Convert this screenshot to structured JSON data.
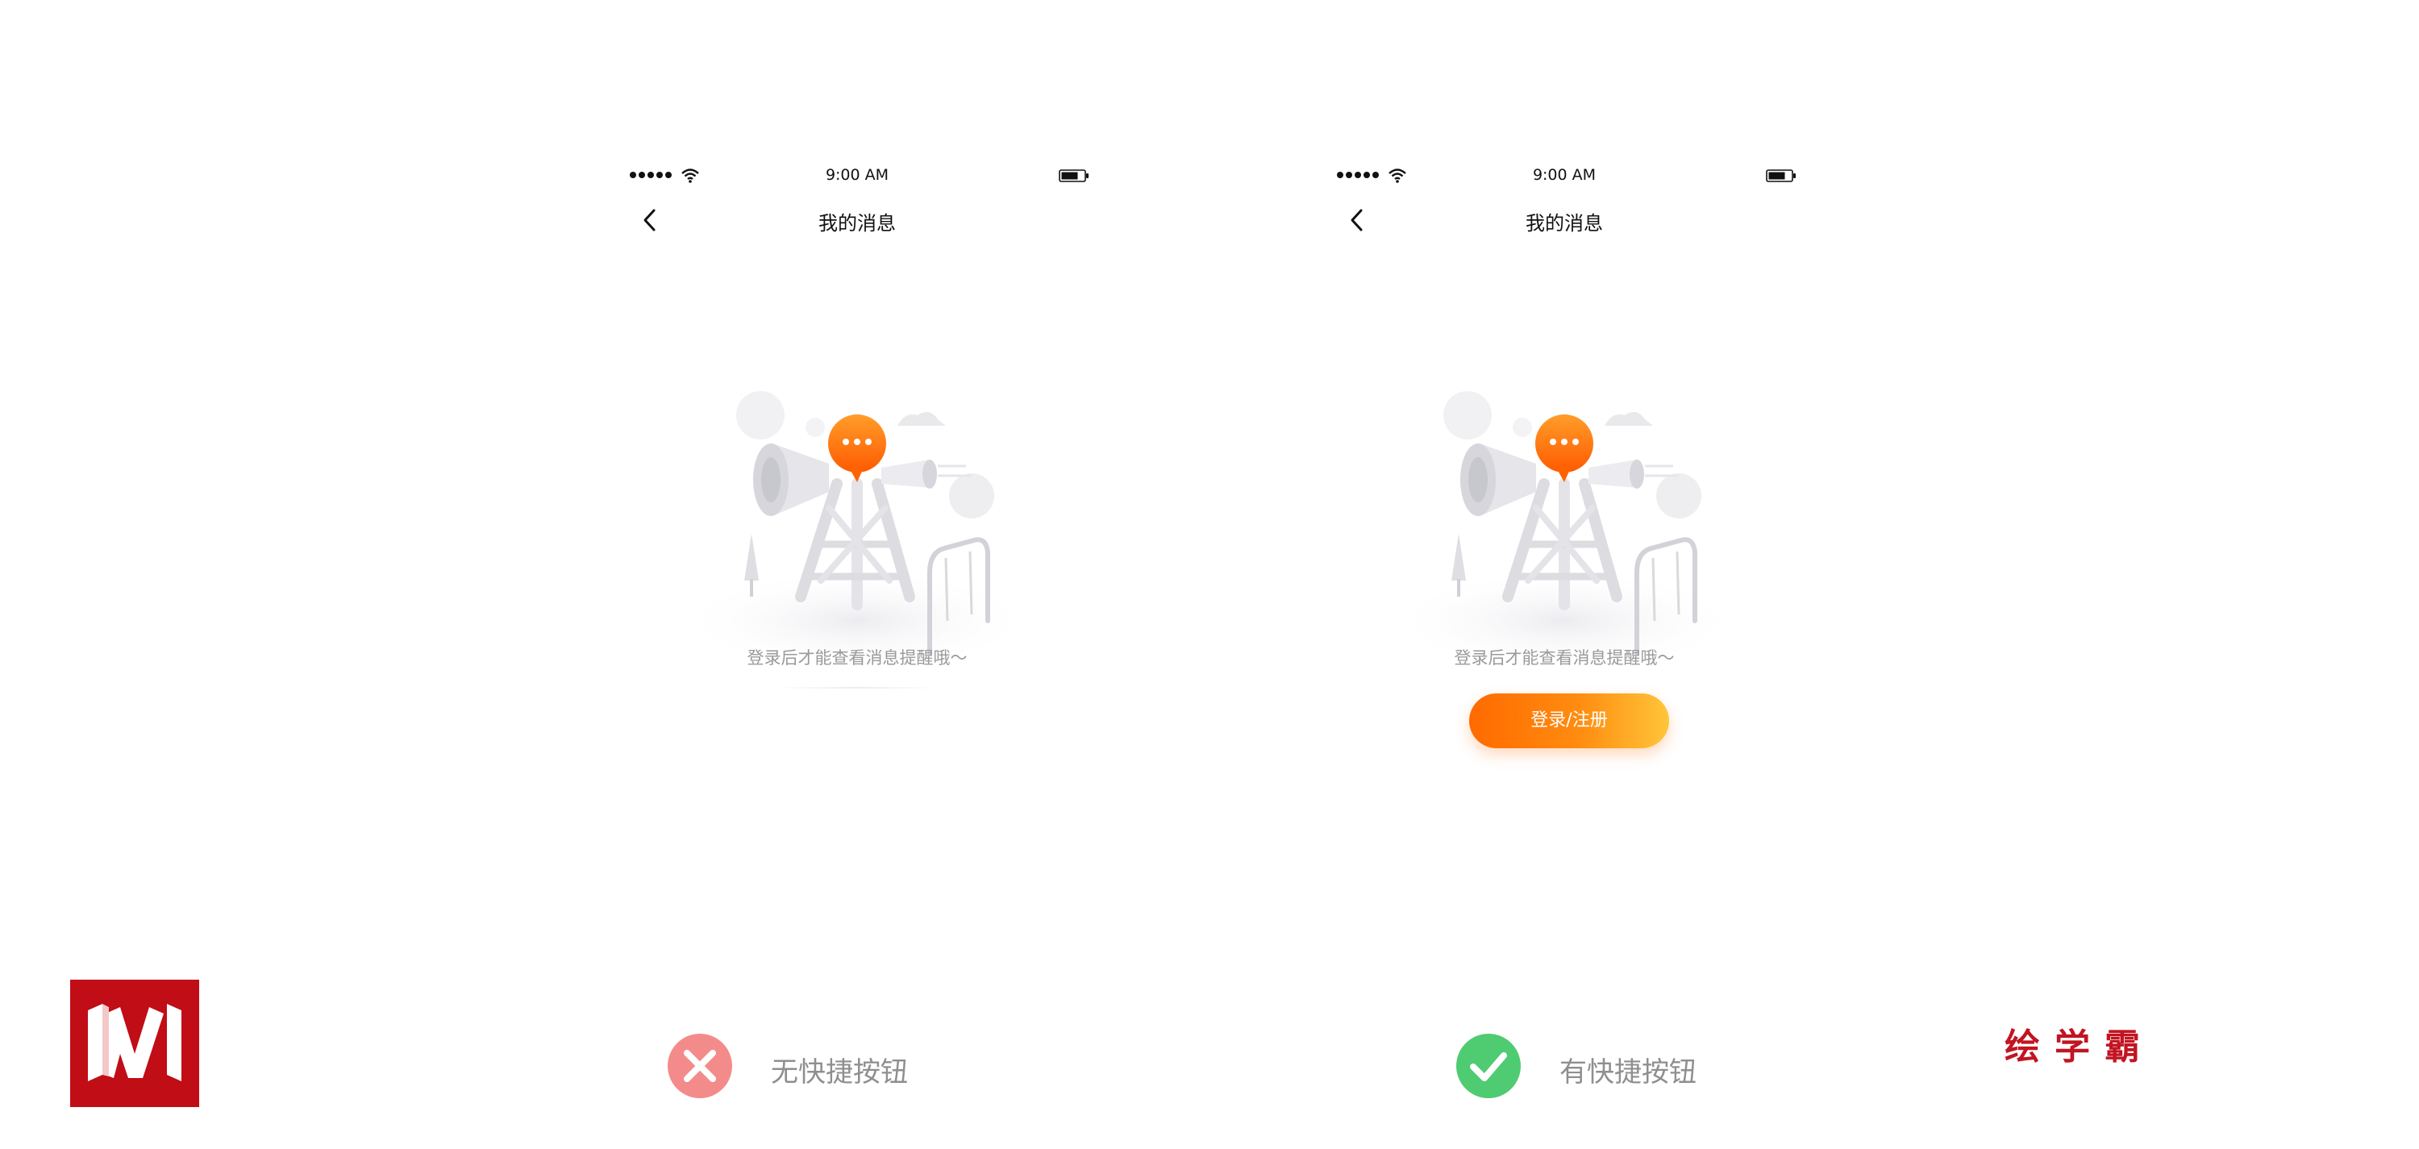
{
  "screens": [
    {
      "status": {
        "time": "9:00 AM"
      },
      "nav": {
        "title": "我的消息"
      },
      "empty_message": "登录后才能查看消息提醒哦～"
    },
    {
      "status": {
        "time": "9:00 AM"
      },
      "nav": {
        "title": "我的消息"
      },
      "empty_message": "登录后才能查看消息提醒哦～",
      "login_button_label": "登录/注册"
    }
  ],
  "captions": [
    {
      "text": "无快捷按钮",
      "status": "incorrect",
      "icon": "cross-icon",
      "color": "#f48b8b"
    },
    {
      "text": "有快捷按钮",
      "status": "correct",
      "icon": "check-icon",
      "color": "#4fcb72"
    }
  ],
  "brand": {
    "text": "绘学霸"
  },
  "colors": {
    "accent_start": "#ff6a00",
    "accent_end": "#ffc53a",
    "logo_red": "#c00d16"
  }
}
